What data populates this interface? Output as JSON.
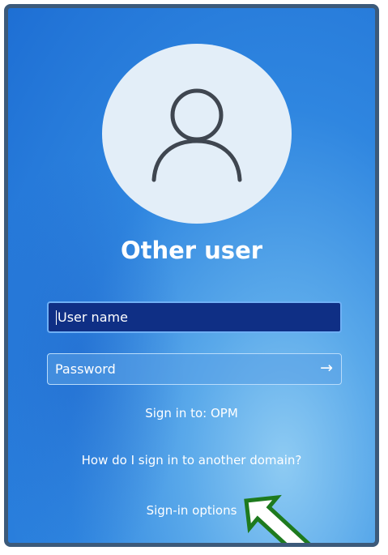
{
  "title": "Other user",
  "username": {
    "placeholder": "User name",
    "value": ""
  },
  "password": {
    "placeholder": "Password",
    "value": "",
    "submit_icon": "arrow-right-icon"
  },
  "signin_to": "Sign in to: OPM",
  "domain_help": "How do I sign in to another domain?",
  "signin_options": "Sign-in options",
  "avatar_icon": "user-silhouette-icon",
  "annotation_icon": "green-arrow-icon",
  "colors": {
    "background": "#2f86e0",
    "active_field": "#0f2f85",
    "annotation_arrow": "#1e7a1e",
    "frame_border": "#3c5a7a"
  }
}
